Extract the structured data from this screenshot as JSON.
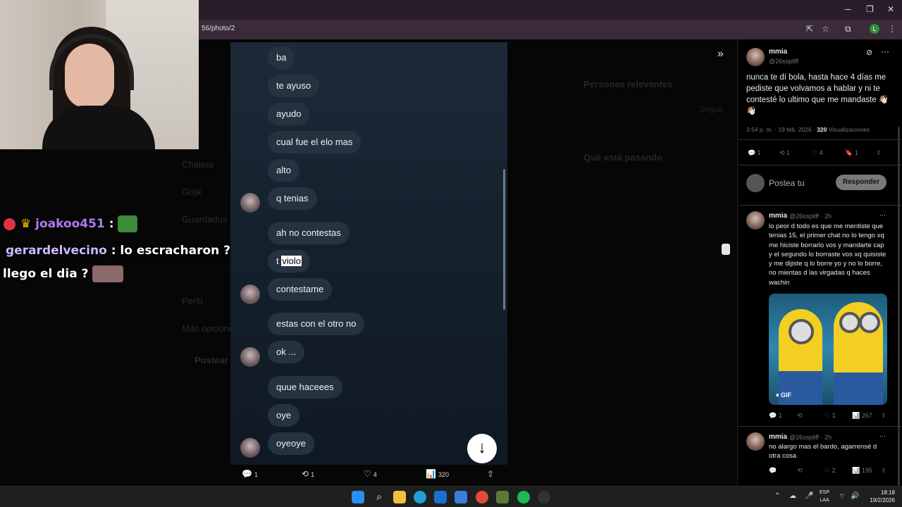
{
  "browser": {
    "url": "56/photo/2",
    "profile_initial": "L"
  },
  "stream_chat": [
    {
      "user": "joakoo451",
      "separator": ":",
      "message": ""
    },
    {
      "user": "gerardelvecino",
      "separator": ":",
      "message": "lo escracharon ?"
    },
    {
      "user": "",
      "separator": "",
      "message": "llego el dia ?"
    }
  ],
  "photo": {
    "messages": [
      "ba",
      "te ayuso",
      "ayudo",
      "cual fue el elo mas",
      "alto",
      "q tenias",
      "ah no contestas",
      "t",
      "violo",
      "contestame",
      "estas con el otro no",
      "ok ...",
      "quue  haceees",
      "oye",
      "oyeoye"
    ],
    "actions": {
      "replies": "1",
      "reposts": "1",
      "likes": "4",
      "views": "320"
    }
  },
  "backdrop": {
    "nav": [
      "Chatear",
      "Grok",
      "Guardados",
      "Perfil",
      "Más opciones",
      "Postear"
    ],
    "right": {
      "relevant_title": "Personas relevantes",
      "trending_title": "Qué está pasando",
      "follow": "Seguir"
    }
  },
  "panel": {
    "main_post": {
      "name": "mmia",
      "handle": "@26sspliff",
      "text": "nunca te dí bola, hasta hace 4 días me pediste que volvamos a hablar y ni te contesté lo ultimo que me mandaste 👋🏻👋🏻",
      "time": "3:54 p. m. · 19 feb. 2026 ·",
      "views": "320",
      "views_label": "Visualizaciones",
      "stats": {
        "replies": "1",
        "reposts": "1",
        "likes": "4",
        "bookmarks": "1"
      }
    },
    "reply_placeholder": "Postea tu",
    "reply_button": "Responder",
    "reply1": {
      "name": "mmia",
      "handle": "@26sspliff · 2h",
      "text": "lo peor d todo es que me mentiste que tenias 15, el primer chat no lo tengo xq me hiciste borrarlo vos y mandarte cap y el segundo lo borraste vos xq quisiste y me dijiste q lo borre yo y no lo borre, no mientas d las virgadas q haces wachin",
      "gif_label": "GIF",
      "stats": {
        "replies": "1",
        "reposts": "",
        "likes": "1",
        "views": "267"
      }
    },
    "reply2": {
      "name": "mmia",
      "handle": "@26sspliff · 2h",
      "text": "no alargo mas el bardo, agarrensé d otra cosa",
      "stats": {
        "replies": "",
        "reposts": "",
        "likes": "2",
        "views": "195"
      }
    }
  },
  "taskbar": {
    "lang_top": "ESP",
    "lang_bottom": "LAA",
    "time": "18:18",
    "date": "19/2/2026"
  }
}
